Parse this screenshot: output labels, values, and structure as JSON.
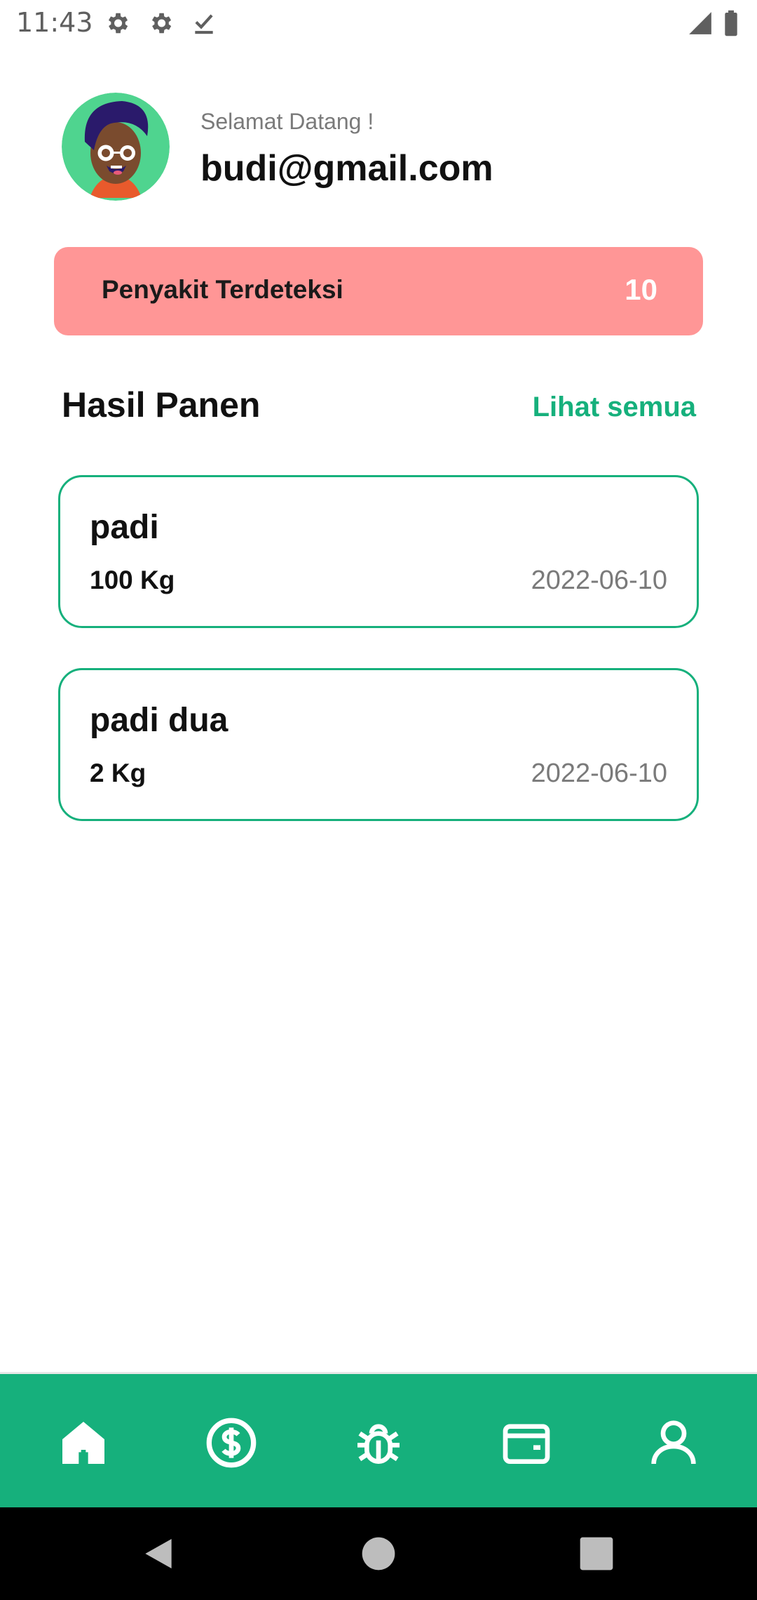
{
  "status_bar": {
    "time": "11:43",
    "icons": [
      "gear-icon",
      "gear-icon",
      "download-done-icon",
      "signal-icon",
      "battery-icon"
    ]
  },
  "header": {
    "greeting": "Selamat Datang !",
    "email": "budi@gmail.com"
  },
  "disease_card": {
    "label": "Penyakit Terdeteksi",
    "count": "10",
    "color": "#ff9696"
  },
  "harvest_section": {
    "title": "Hasil Panen",
    "see_all": "Lihat semua",
    "items": [
      {
        "name": "padi",
        "weight": "100 Kg",
        "date": "2022-06-10"
      },
      {
        "name": "padi dua",
        "weight": "2 Kg",
        "date": "2022-06-10"
      }
    ]
  },
  "bottom_nav": {
    "items": [
      "home-icon",
      "dollar-icon",
      "bug-icon",
      "wallet-icon",
      "profile-icon"
    ]
  },
  "system_nav": {
    "items": [
      "back-icon",
      "home-circle-icon",
      "recents-icon"
    ]
  },
  "colors": {
    "accent": "#16b07c",
    "alert": "#ff9696"
  }
}
